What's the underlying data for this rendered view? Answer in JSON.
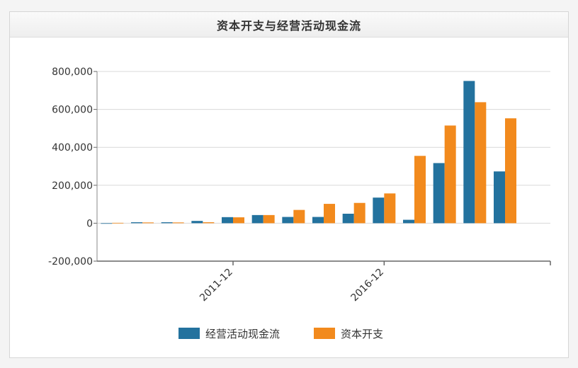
{
  "title": "资本开支与经营活动现金流",
  "chart_data": {
    "type": "bar",
    "title": "资本开支与经营活动现金流",
    "categories": [
      "",
      "",
      "",
      "",
      "2011-12",
      "",
      "",
      "",
      "",
      "2016-12",
      "",
      "",
      "",
      "",
      ""
    ],
    "series": [
      {
        "name": "经营活动现金流",
        "color": "#23729e",
        "values": [
          -2000,
          5000,
          5000,
          12000,
          32000,
          43000,
          33000,
          33000,
          50000,
          135000,
          18000,
          317000,
          750000,
          273000,
          null
        ]
      },
      {
        "name": "资本开支",
        "color": "#f28a1d",
        "values": [
          2000,
          4000,
          4000,
          5000,
          31000,
          43000,
          70000,
          102000,
          107000,
          157000,
          355000,
          515000,
          638000,
          553000,
          null
        ]
      }
    ],
    "yticks": [
      "800,000",
      "600,000",
      "400,000",
      "200,000",
      "0",
      "-200,000"
    ],
    "ytick_values": [
      800000,
      600000,
      400000,
      200000,
      0,
      -200000
    ],
    "ylim": [
      -200000,
      800000
    ],
    "xtick_labels": [
      "2011-12",
      "2016-12"
    ],
    "grid": true,
    "legend": "bottom-center",
    "xlabel": "",
    "ylabel": ""
  }
}
